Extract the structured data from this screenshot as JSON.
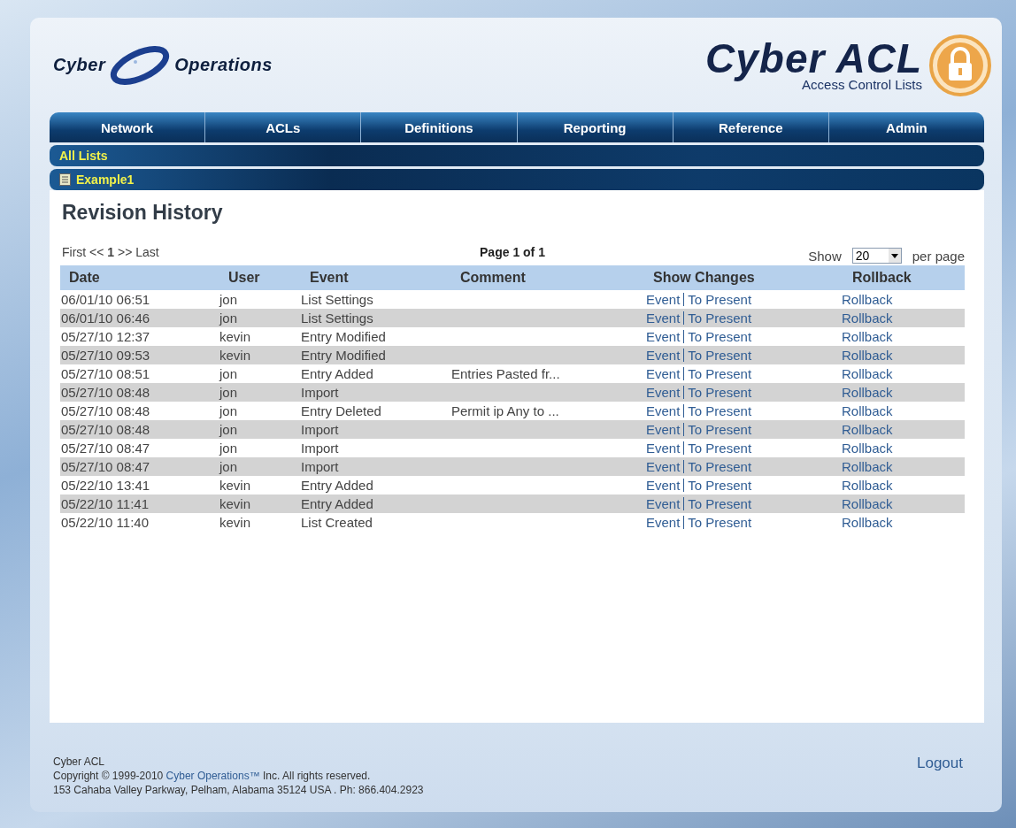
{
  "header": {
    "logo_left": [
      "Cyber",
      "Operations"
    ],
    "logo_title": "Cyber ACL",
    "logo_subtitle": "Access Control Lists"
  },
  "nav": [
    {
      "label": "Network"
    },
    {
      "label": "ACLs"
    },
    {
      "label": "Definitions"
    },
    {
      "label": "Reporting"
    },
    {
      "label": "Reference"
    },
    {
      "label": "Admin"
    }
  ],
  "breadcrumb": {
    "label": "All Lists"
  },
  "list_bar": {
    "label": "Example1"
  },
  "page_title": "Revision History",
  "pager": {
    "links": "First << **1** >> Last",
    "page_info": "Page 1 of 1",
    "show_label": "Show",
    "per_page": "20",
    "per_page_suffix": "per page"
  },
  "table": {
    "columns": [
      "Date",
      "User",
      "Event",
      "Comment",
      "Show Changes",
      "Rollback"
    ],
    "rows": [
      {
        "date": "06/01/10 06:51",
        "user": "jon",
        "event": "List Settings",
        "comment": "",
        "changes_event": "Event",
        "changes_present": "To Present",
        "rollback": "Rollback"
      },
      {
        "date": "06/01/10 06:46",
        "user": "jon",
        "event": "List Settings",
        "comment": "",
        "changes_event": "Event",
        "changes_present": "To Present",
        "rollback": "Rollback"
      },
      {
        "date": "05/27/10 12:37",
        "user": "kevin",
        "event": "Entry Modified",
        "comment": "",
        "changes_event": "Event",
        "changes_present": "To Present",
        "rollback": "Rollback"
      },
      {
        "date": "05/27/10 09:53",
        "user": "kevin",
        "event": "Entry Modified",
        "comment": "",
        "changes_event": "Event",
        "changes_present": "To Present",
        "rollback": "Rollback"
      },
      {
        "date": "05/27/10 08:51",
        "user": "jon",
        "event": "Entry Added",
        "comment": "Entries Pasted fr...",
        "changes_event": "Event",
        "changes_present": "To Present",
        "rollback": "Rollback"
      },
      {
        "date": "05/27/10 08:48",
        "user": "jon",
        "event": "Import",
        "comment": "",
        "changes_event": "Event",
        "changes_present": "To Present",
        "rollback": "Rollback"
      },
      {
        "date": "05/27/10 08:48",
        "user": "jon",
        "event": "Entry Deleted",
        "comment": "Permit ip Any to ...",
        "changes_event": "Event",
        "changes_present": "To Present",
        "rollback": "Rollback"
      },
      {
        "date": "05/27/10 08:48",
        "user": "jon",
        "event": "Import",
        "comment": "",
        "changes_event": "Event",
        "changes_present": "To Present",
        "rollback": "Rollback"
      },
      {
        "date": "05/27/10 08:47",
        "user": "jon",
        "event": "Import",
        "comment": "",
        "changes_event": "Event",
        "changes_present": "To Present",
        "rollback": "Rollback"
      },
      {
        "date": "05/27/10 08:47",
        "user": "jon",
        "event": "Import",
        "comment": "",
        "changes_event": "Event",
        "changes_present": "To Present",
        "rollback": "Rollback"
      },
      {
        "date": "05/22/10 13:41",
        "user": "kevin",
        "event": "Entry Added",
        "comment": "",
        "changes_event": "Event",
        "changes_present": "To Present",
        "rollback": "Rollback"
      },
      {
        "date": "05/22/10 11:41",
        "user": "kevin",
        "event": "Entry Added",
        "comment": "",
        "changes_event": "Event",
        "changes_present": "To Present",
        "rollback": "Rollback"
      },
      {
        "date": "05/22/10 11:40",
        "user": "kevin",
        "event": "List Created",
        "comment": "",
        "changes_event": "Event",
        "changes_present": "To Present",
        "rollback": "Rollback"
      }
    ]
  },
  "footer": {
    "product": "Cyber ACL",
    "copyright_before": "Copyright © 1999-2010",
    "copyright_link": "Cyber Operations™",
    "copyright_after": "Inc. All rights reserved.",
    "address": "153 Cahaba Valley Parkway, Pelham, Alabama 35124 USA . Ph: 866.404.2923",
    "logout": "Logout"
  }
}
